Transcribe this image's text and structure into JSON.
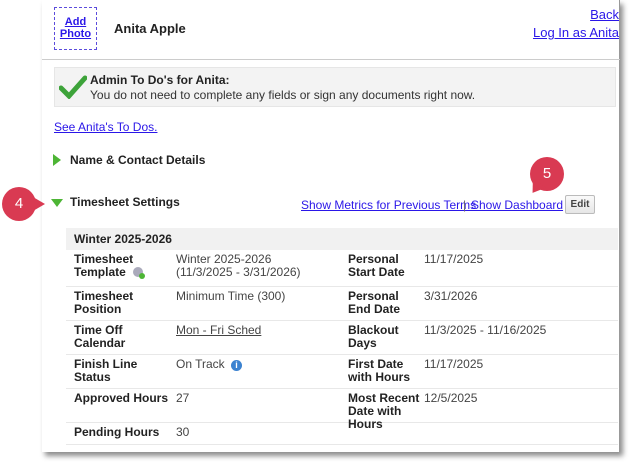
{
  "header": {
    "add_photo": "Add Photo",
    "name": "Anita Apple",
    "back": "Back",
    "login_as": "Log In as Anita"
  },
  "todo": {
    "title": "Admin To Do's for Anita:",
    "message": "You do not need to complete any fields or sign any documents right now.",
    "see_link": "See Anita's To Dos."
  },
  "sections": {
    "name_contact": "Name & Contact Details",
    "timesheet": "Timesheet Settings",
    "show_metrics": "Show Metrics for Previous Terms",
    "separator": "|",
    "show_dashboard": "Show Dashboard",
    "edit": "Edit"
  },
  "callouts": {
    "four": "4",
    "five": "5"
  },
  "table": {
    "header": "Winter 2025-2026",
    "rows": [
      {
        "l1": "Timesheet Template",
        "v1": "Winter 2025-2026\n(11/3/2025 - 3/31/2026)",
        "l2": "Personal Start Date",
        "v2": "11/17/2025"
      },
      {
        "l1": "Timesheet Position",
        "v1": "Minimum Time (300)",
        "l2": "Personal End Date",
        "v2": "3/31/2026"
      },
      {
        "l1": "Time Off Calendar",
        "v1": "Mon - Fri Sched",
        "l2": "Blackout Days",
        "v2": "11/3/2025 - 11/16/2025"
      },
      {
        "l1": "Finish Line Status",
        "v1": "On Track",
        "l2": "First Date with Hours",
        "v2": "11/17/2025"
      },
      {
        "l1": "Approved Hours",
        "v1": "27",
        "l2": "Most Recent Date with Hours",
        "v2": "12/5/2025"
      },
      {
        "l1": "Pending Hours",
        "v1": "30",
        "l2": "",
        "v2": ""
      }
    ]
  },
  "colors": {
    "link": "#2a16e8",
    "green": "#4db535",
    "callout": "#d93a52"
  }
}
